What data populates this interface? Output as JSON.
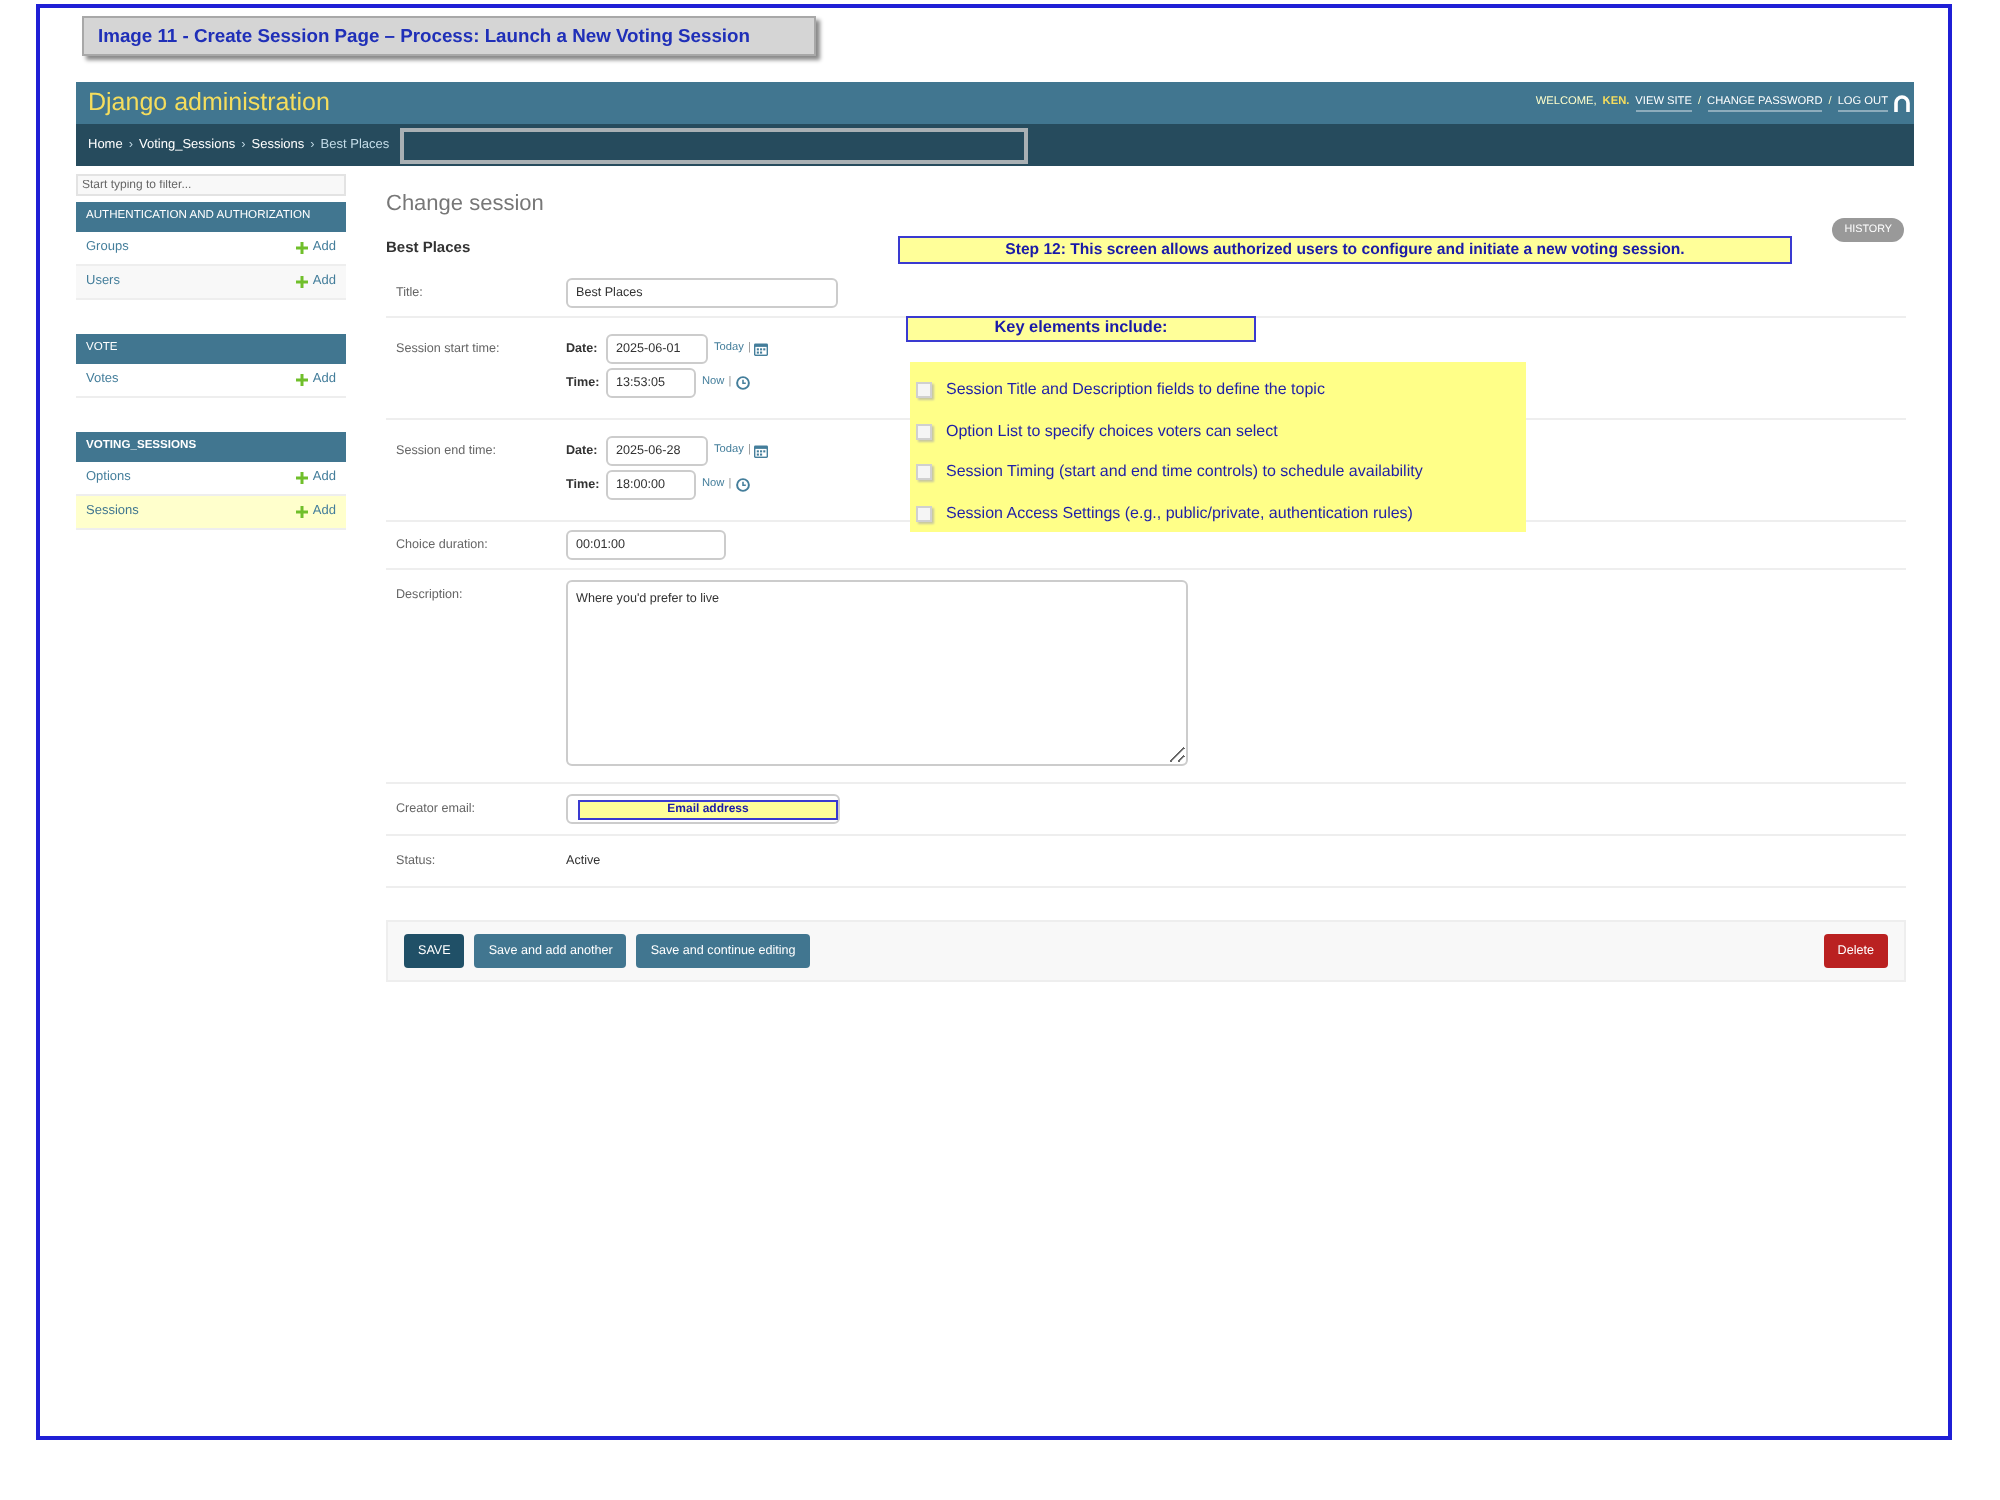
{
  "caption": "Image 11 - Create Session Page – Process: Launch a New Voting Session",
  "header": {
    "title": "Django administration",
    "welcome": "WELCOME,",
    "user": "KEN.",
    "links": [
      "VIEW SITE",
      "CHANGE PASSWORD",
      "LOG OUT"
    ],
    "separators": [
      "/",
      "/"
    ]
  },
  "breadcrumbs": {
    "items": [
      "Home",
      "Voting_Sessions",
      "Sessions",
      "Best Places"
    ],
    "separators": [
      "›",
      "›",
      "›"
    ]
  },
  "sidebar": {
    "filter_placeholder": "Start typing to filter...",
    "modules": [
      {
        "caption": "AUTHENTICATION AND AUTHORIZATION",
        "current": false,
        "models": [
          {
            "name": "Groups",
            "add": "Add",
            "selected": false
          },
          {
            "name": "Users",
            "add": "Add",
            "selected": false
          }
        ]
      },
      {
        "caption": "VOTE",
        "current": false,
        "models": [
          {
            "name": "Votes",
            "add": "Add",
            "selected": false
          }
        ]
      },
      {
        "caption": "VOTING_SESSIONS",
        "current": true,
        "models": [
          {
            "name": "Options",
            "add": "Add",
            "selected": false
          },
          {
            "name": "Sessions",
            "add": "Add",
            "selected": true
          }
        ]
      }
    ]
  },
  "form": {
    "heading": "Change session",
    "history_button": "HISTORY",
    "fieldset_title": "Best Places",
    "rows": [
      {
        "kind": "text",
        "label": "Title:",
        "value": "Best Places"
      },
      {
        "kind": "datetime",
        "label": "Session start time:",
        "date_label": "Date:",
        "date": "2025-06-01",
        "today_link": "Today",
        "date_separator": "|",
        "time_label": "Time:",
        "time": "13:53:05",
        "now_link": "Now",
        "time_separator": "|"
      },
      {
        "kind": "datetime",
        "label": "Session end time:",
        "date_label": "Date:",
        "date": "2025-06-28",
        "today_link": "Today",
        "date_separator": "|",
        "time_label": "Time:",
        "time": "18:00:00",
        "now_link": "Now",
        "time_separator": "|"
      },
      {
        "kind": "short",
        "label": "Choice duration:",
        "value": "00:01:00"
      },
      {
        "kind": "textarea",
        "label": "Description:",
        "value": "Where you'd prefer to live"
      },
      {
        "kind": "email",
        "label": "Creator email:",
        "annotation": "Email address"
      },
      {
        "kind": "readonly",
        "label": "Status:",
        "value": "Active"
      }
    ],
    "buttons": [
      {
        "kind": "default",
        "label": "SAVE"
      },
      {
        "kind": "secondary",
        "label": "Save and add another"
      },
      {
        "kind": "secondary",
        "label": "Save and continue editing"
      },
      {
        "kind": "delete",
        "label": "Delete"
      }
    ]
  },
  "annotations": {
    "step": "Step 12: This screen allows authorized users to configure and initiate a new voting session.",
    "key_heading": "Key elements include:",
    "key_items": [
      {
        "text": "Session Title and Description fields to define the topic",
        "checked": false
      },
      {
        "text": "Option List to specify choices voters can select",
        "checked": false
      },
      {
        "text": "Session Timing (start and end time controls) to schedule availability",
        "checked": false
      },
      {
        "text": "Session Access Settings (e.g., public/private, authentication rules)",
        "checked": false
      }
    ]
  }
}
